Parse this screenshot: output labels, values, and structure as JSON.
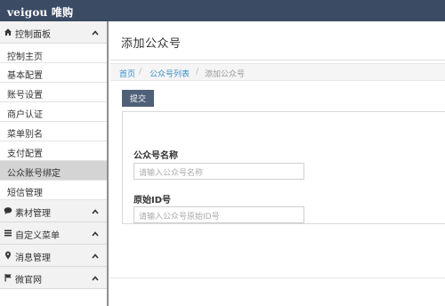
{
  "app": {
    "brand": "veigou 唯购"
  },
  "sidebar": {
    "control_panel": {
      "label": "控制面板",
      "icon": "home-icon"
    },
    "control_items": [
      {
        "label": "控制主页",
        "active": false
      },
      {
        "label": "基本配置",
        "active": false
      },
      {
        "label": "账号设置",
        "active": false
      },
      {
        "label": "商户认证",
        "active": false
      },
      {
        "label": "菜单别名",
        "active": false
      },
      {
        "label": "支付配置",
        "active": false
      },
      {
        "label": "公众账号绑定",
        "active": true
      },
      {
        "label": "短信管理",
        "active": false
      }
    ],
    "sections": [
      {
        "label": "素材管理",
        "icon": "comment-icon"
      },
      {
        "label": "自定义菜单",
        "icon": "list-icon"
      },
      {
        "label": "消息管理",
        "icon": "map-marker-icon"
      },
      {
        "label": "微官网",
        "icon": "flag-icon"
      }
    ]
  },
  "main": {
    "title": "添加公众号",
    "breadcrumb": {
      "home": "首页",
      "list": "公众号列表",
      "current": "添加公众号",
      "separator": "/"
    },
    "submit_label": "提交",
    "form": {
      "name_label": "公众号名称",
      "name_placeholder": "请输入公众号名称",
      "id_label": "原始ID号",
      "id_placeholder": "请输入公众号原始ID号"
    }
  },
  "colors": {
    "topbar": "#3c4b64",
    "button": "#4f6079",
    "link": "#3b8ec7",
    "active_item": "#d4d4d4"
  }
}
